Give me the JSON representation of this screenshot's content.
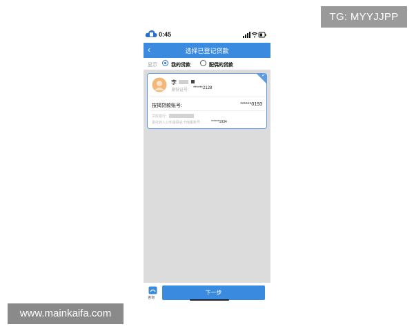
{
  "watermarks": {
    "top_right": "TG: MYYJJPP",
    "bottom_left": "www.mainkaifa.com"
  },
  "status_bar": {
    "time": "0:45",
    "icons": [
      "signal-icon",
      "wifi-icon",
      "battery-icon"
    ]
  },
  "header": {
    "back_glyph": "‹",
    "title": "选择已登记贷款"
  },
  "display_filter": {
    "label": "显示",
    "options": [
      {
        "label": "我的贷款",
        "selected": true
      },
      {
        "label": "配偶的贷款",
        "selected": false
      }
    ]
  },
  "loan_card": {
    "selected": true,
    "check_glyph": "✓",
    "name": "李",
    "id_label": "身份证号:",
    "id_value": "******2128",
    "loan_account_label": "按揭贷款账号:",
    "loan_account_value": "******0193",
    "bank_label": "贷款银行:",
    "fund_account_label": "委托转入公积金联名卡储蓄账号:",
    "fund_account_value": "******1934"
  },
  "footer": {
    "consult_label": "咨询",
    "next_label": "下一步"
  },
  "colors": {
    "primary": "#3a8be0",
    "card_border": "#5f9be3",
    "background": "#dcdcdc",
    "avatar": "#f3b77a"
  }
}
